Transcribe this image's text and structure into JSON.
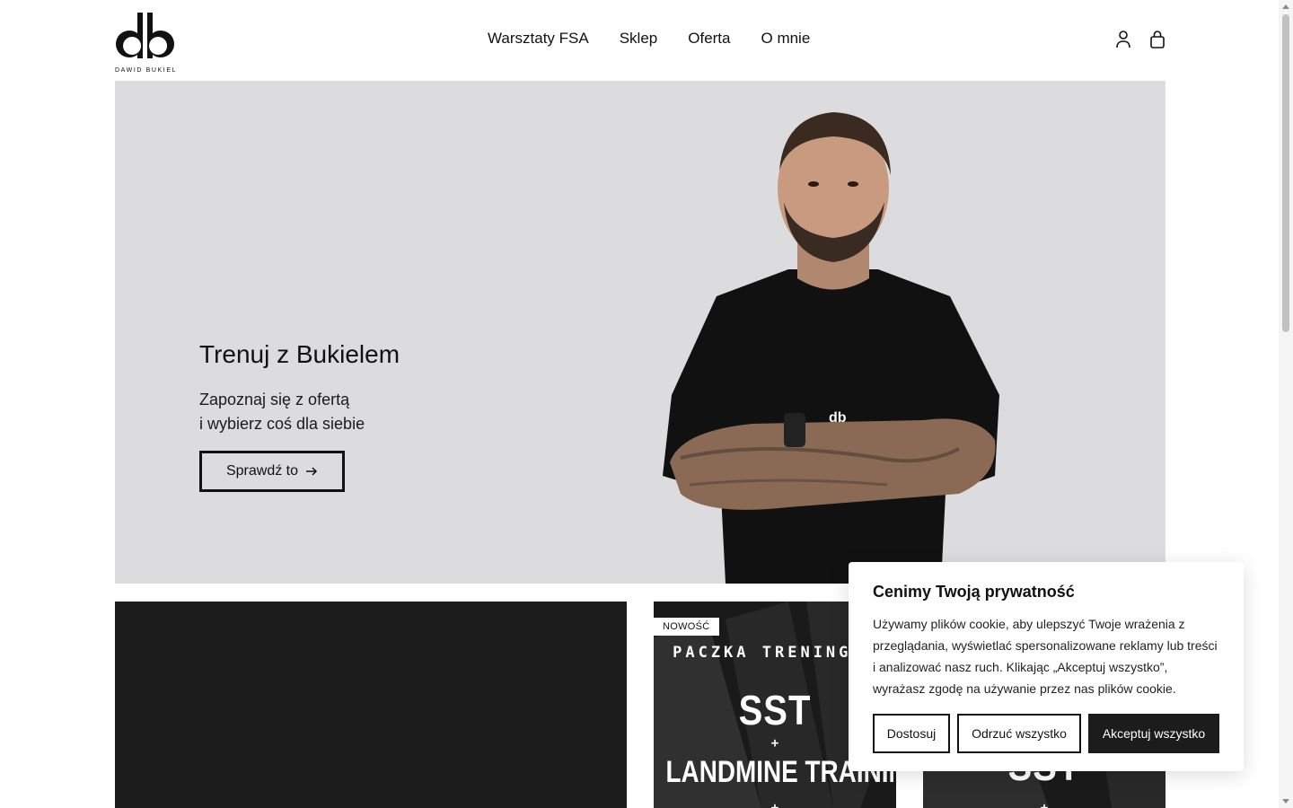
{
  "header": {
    "logo_text": "DAWID BUKIEL",
    "nav": [
      {
        "label": "Warsztaty FSA"
      },
      {
        "label": "Sklep"
      },
      {
        "label": "Oferta"
      },
      {
        "label": "O mnie"
      }
    ],
    "icons": [
      "account-icon",
      "cart-bag-icon"
    ]
  },
  "hero": {
    "title": "Trenuj z Bukielem",
    "subtitle_line1": "Zapoznaj się z ofertą",
    "subtitle_line2": "i wybierz coś dla siebie",
    "cta_label": "Sprawdź to",
    "cta_icon": "arrow-right-icon",
    "background": "#dcdcde"
  },
  "products": [
    {
      "badge": "NOWOŚĆ",
      "line1": "PACZKA TRENINGOW",
      "line2": "SST",
      "plus": "+",
      "line3": "LANDMINE TRAINING",
      "plus2": "+"
    },
    {
      "line2": "SST",
      "plus": "+"
    }
  ],
  "cookie": {
    "title": "Cenimy Twoją prywatność",
    "text": "Używamy plików cookie, aby ulepszyć Twoje wrażenia z przeglądania, wyświetlać spersonalizowane reklamy lub treści i analizować nasz ruch. Klikając „Akceptuj wszystko”, wyrażasz zgodę na używanie przez nas plików cookie.",
    "customize_label": "Dostosuj",
    "reject_label": "Odrzuć wszystko",
    "accept_label": "Akceptuj wszystko"
  },
  "colors": {
    "text": "#111111",
    "hero_bg": "#dcdcde",
    "dark": "#1c1c1c"
  }
}
